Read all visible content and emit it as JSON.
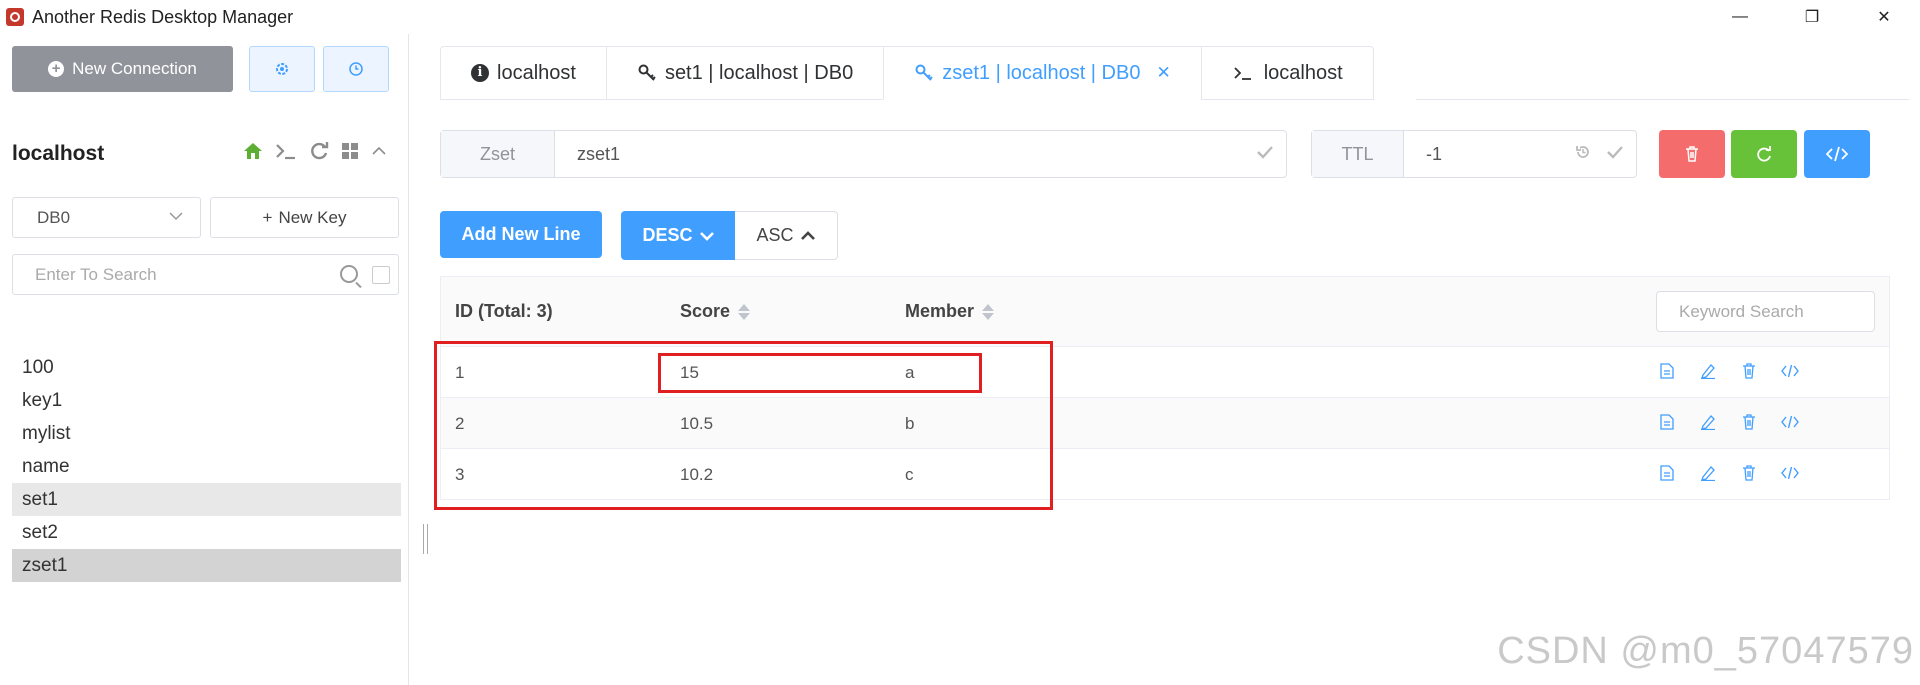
{
  "window": {
    "title": "Another Redis Desktop Manager",
    "controls": {
      "minimize": "—",
      "restore": "❐",
      "close": "✕"
    }
  },
  "sidebar": {
    "new_connection_label": "New Connection",
    "settings_icon": "gear-icon",
    "history_icon": "clock-icon",
    "connection_name": "localhost",
    "db_select": {
      "value": "DB0"
    },
    "new_key_label": "New Key",
    "search_placeholder": "Enter To Search",
    "keys": [
      "100",
      "key1",
      "mylist",
      "name",
      "set1",
      "set2",
      "zset1"
    ]
  },
  "tabs": [
    {
      "label": "localhost",
      "icon": "info-icon"
    },
    {
      "label": "set1 | localhost | DB0",
      "icon": "key-icon"
    },
    {
      "label": "zset1 | localhost | DB0",
      "icon": "key-icon",
      "active": true
    },
    {
      "label": "localhost",
      "icon": "terminal-icon"
    }
  ],
  "key_header": {
    "type_label": "Zset",
    "key_name": "zset1",
    "ttl_label": "TTL",
    "ttl_value": "-1"
  },
  "actions": {
    "add_new_line": "Add New Line",
    "desc": "DESC",
    "asc": "ASC"
  },
  "table": {
    "headers": {
      "id": "ID (Total: 3)",
      "score": "Score",
      "member": "Member"
    },
    "keyword_placeholder": "Keyword Search",
    "rows": [
      {
        "id": "1",
        "score": "15",
        "member": "a"
      },
      {
        "id": "2",
        "score": "10.5",
        "member": "b"
      },
      {
        "id": "3",
        "score": "10.2",
        "member": "c"
      }
    ]
  },
  "colors": {
    "primary": "#409eff",
    "danger": "#f56c6c",
    "success": "#67c23a",
    "highlight_box": "#e02020"
  },
  "watermark": "CSDN @m0_57047579"
}
